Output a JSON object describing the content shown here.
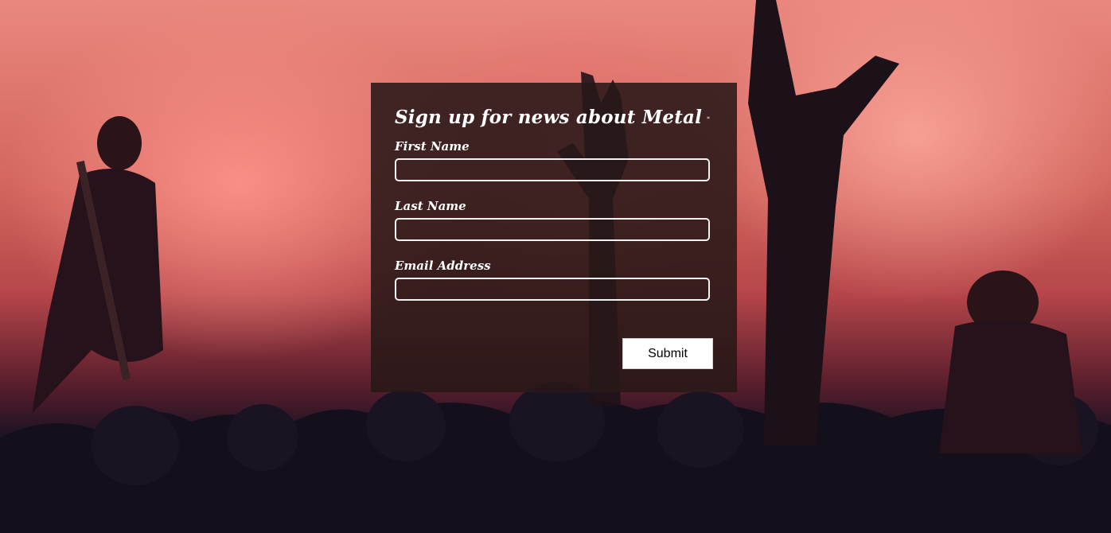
{
  "form": {
    "title": "Sign up for news about Metal",
    "title_icon": "rock-hands-icon",
    "fields": [
      {
        "label": "First Name",
        "value": "",
        "placeholder": ""
      },
      {
        "label": "Last Name",
        "value": "",
        "placeholder": ""
      },
      {
        "label": "Email Address",
        "value": "",
        "placeholder": ""
      }
    ],
    "submit_label": "Submit"
  },
  "colors": {
    "panel_bg": "#281818",
    "text": "#ffffff",
    "input_border": "#f2f2f2",
    "button_bg": "#ffffff"
  }
}
